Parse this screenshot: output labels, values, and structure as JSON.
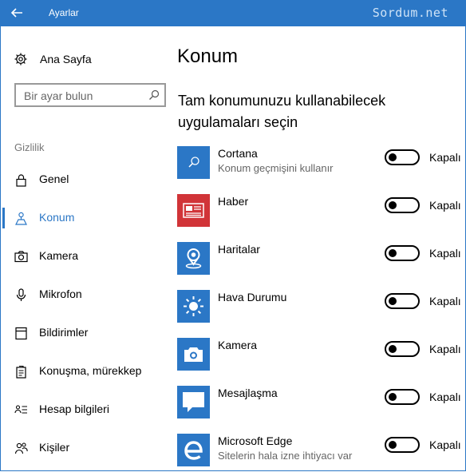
{
  "window": {
    "title": "Ayarlar",
    "watermark": "Sordum.net"
  },
  "sidebar": {
    "home_label": "Ana Sayfa",
    "search_placeholder": "Bir ayar bulun",
    "section_label": "Gizlilik",
    "items": [
      {
        "label": "Genel",
        "icon": "lock-icon",
        "active": false
      },
      {
        "label": "Konum",
        "icon": "location-icon",
        "active": true
      },
      {
        "label": "Kamera",
        "icon": "camera-icon",
        "active": false
      },
      {
        "label": "Mikrofon",
        "icon": "microphone-icon",
        "active": false
      },
      {
        "label": "Bildirimler",
        "icon": "notifications-icon",
        "active": false
      },
      {
        "label": "Konuşma, mürekkep",
        "icon": "speech-ink-icon",
        "active": false
      },
      {
        "label": "Hesap bilgileri",
        "icon": "account-info-icon",
        "active": false
      },
      {
        "label": "Kişiler",
        "icon": "people-icon",
        "active": false
      }
    ]
  },
  "main": {
    "title": "Konum",
    "subtitle_line1": "Tam konumunuzu kullanabilecek",
    "subtitle_line2": "uygulamaları  seçin",
    "apps": [
      {
        "name": "Cortana",
        "desc": "Konum geçmişini kullanır",
        "state": "Kapalı",
        "on": false,
        "tile_color": "#2b77c6",
        "icon": "search-icon"
      },
      {
        "name": "Haber",
        "desc": "",
        "state": "Kapalı",
        "on": false,
        "tile_color": "#d13438",
        "icon": "news-icon"
      },
      {
        "name": "Haritalar",
        "desc": "",
        "state": "Kapalı",
        "on": false,
        "tile_color": "#2b77c6",
        "icon": "maps-icon"
      },
      {
        "name": "Hava Durumu",
        "desc": "",
        "state": "Kapalı",
        "on": false,
        "tile_color": "#2b77c6",
        "icon": "weather-icon"
      },
      {
        "name": "Kamera",
        "desc": "",
        "state": "Kapalı",
        "on": false,
        "tile_color": "#2b77c6",
        "icon": "camera-icon"
      },
      {
        "name": "Mesajlaşma",
        "desc": "",
        "state": "Kapalı",
        "on": false,
        "tile_color": "#2b77c6",
        "icon": "messaging-icon"
      },
      {
        "name": "Microsoft Edge",
        "desc": "Sitelerin hala izne ihtiyacı var",
        "state": "Kapalı",
        "on": false,
        "tile_color": "#2b77c6",
        "icon": "edge-icon"
      }
    ]
  },
  "colors": {
    "accent": "#2b77c6",
    "news_red": "#d13438"
  }
}
